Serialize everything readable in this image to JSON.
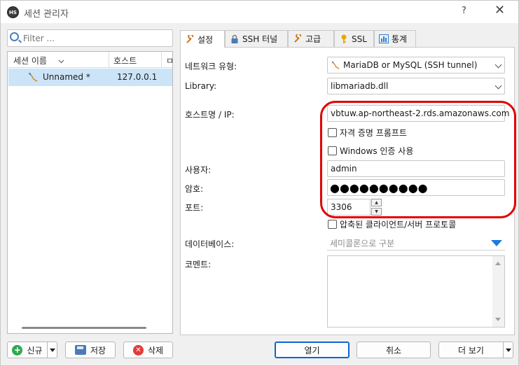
{
  "window": {
    "title": "세션 관리자",
    "icon_text": "HS",
    "help": "?",
    "close": "✕"
  },
  "left": {
    "filter_placeholder": "Filter ...",
    "columns": [
      "세션 이름",
      "호스트",
      "ㅁ"
    ],
    "sessions": [
      {
        "name": "Unnamed *",
        "host": "127.0.0.1"
      }
    ]
  },
  "tabs": [
    {
      "label": "설정",
      "icon": "wrench-icon"
    },
    {
      "label": "SSH 터널",
      "icon": "lock-icon"
    },
    {
      "label": "고급",
      "icon": "wrench-icon"
    },
    {
      "label": "SSL",
      "icon": "key-icon"
    },
    {
      "label": "통계",
      "icon": "chart-icon"
    }
  ],
  "form": {
    "network_type_label": "네트워크 유형:",
    "network_type_value": "MariaDB or MySQL (SSH tunnel)",
    "library_label": "Library:",
    "library_value": "libmariadb.dll",
    "host_label": "호스트명 / IP:",
    "host_value": "vbtuw.ap-northeast-2.rds.amazonaws.com",
    "credential_prompt_label": "자격 증명 프롬프트",
    "windows_auth_label": "Windows 인증 사용",
    "user_label": "사용자:",
    "user_value": "admin",
    "password_label": "암호:",
    "password_mask": "●●●●●●●●●●",
    "port_label": "포트:",
    "port_value": "3306",
    "compressed_label": "압축된 클라이언트/서버 프로토콜",
    "database_label": "데이터베이스:",
    "database_placeholder": "세미콜론으로 구분",
    "comment_label": "코멘트:"
  },
  "buttons": {
    "new": "신규",
    "save": "저장",
    "delete": "삭제",
    "open": "열기",
    "cancel": "취소",
    "more": "더 보기"
  },
  "colors": {
    "highlight_row": "#cce4f7",
    "red_annotation": "#e00000",
    "primary_border": "#0a64d6",
    "dropdown_arrow": "#1e7ae0"
  }
}
